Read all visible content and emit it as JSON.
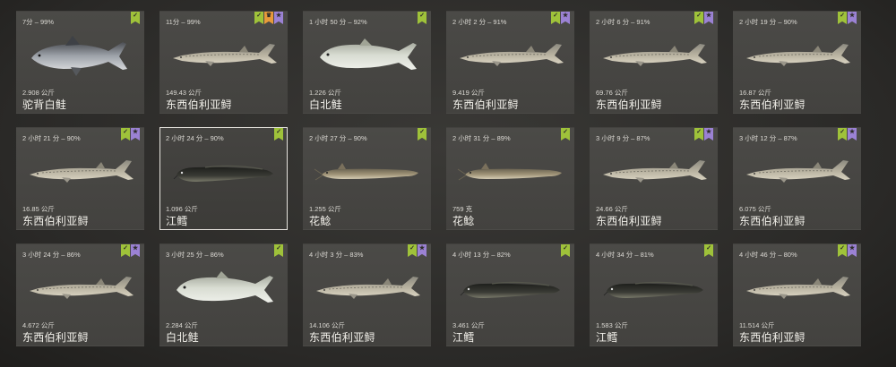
{
  "catches": [
    {
      "time": "7分 – 99%",
      "weight": "2.908 公斤",
      "name": "驼背白鲑",
      "species": "whitefish",
      "badges": [
        "green"
      ]
    },
    {
      "time": "11分 – 99%",
      "weight": "149.43 公斤",
      "name": "东西伯利亚鲟",
      "species": "sturgeon",
      "badges": [
        "green",
        "orange",
        "purple"
      ]
    },
    {
      "time": "1 小时 50 分 – 92%",
      "weight": "1.226 公斤",
      "name": "白北鲑",
      "species": "nelma",
      "badges": [
        "green"
      ]
    },
    {
      "time": "2 小时 2 分 – 91%",
      "weight": "9.419 公斤",
      "name": "东西伯利亚鲟",
      "species": "sturgeon",
      "badges": [
        "green",
        "purple"
      ]
    },
    {
      "time": "2 小时 6 分 – 91%",
      "weight": "69.76 公斤",
      "name": "东西伯利亚鲟",
      "species": "sturgeon",
      "badges": [
        "green",
        "purple"
      ]
    },
    {
      "time": "2 小时 19 分 – 90%",
      "weight": "16.87 公斤",
      "name": "东西伯利亚鲟",
      "species": "sturgeon",
      "badges": [
        "green",
        "purple"
      ]
    },
    {
      "time": "2 小时 21 分 – 90%",
      "weight": "16.85 公斤",
      "name": "东西伯利亚鲟",
      "species": "sturgeon",
      "badges": [
        "green",
        "purple"
      ]
    },
    {
      "time": "2 小时 24 分 – 90%",
      "weight": "1.096 公斤",
      "name": "江鳕",
      "species": "burbot",
      "badges": [
        "green"
      ],
      "selected": true
    },
    {
      "time": "2 小时 27 分 – 90%",
      "weight": "1.255 公斤",
      "name": "花鲶",
      "species": "catfish",
      "badges": [
        "green"
      ]
    },
    {
      "time": "2 小时 31 分 – 89%",
      "weight": "759 克",
      "name": "花鲶",
      "species": "catfish",
      "badges": [
        "green"
      ]
    },
    {
      "time": "3 小时 9 分 – 87%",
      "weight": "24.66 公斤",
      "name": "东西伯利亚鲟",
      "species": "sturgeon",
      "badges": [
        "green",
        "purple"
      ]
    },
    {
      "time": "3 小时 12 分 – 87%",
      "weight": "6.075 公斤",
      "name": "东西伯利亚鲟",
      "species": "sturgeon",
      "badges": [
        "green",
        "purple"
      ]
    },
    {
      "time": "3 小时 24 分 – 86%",
      "weight": "4.672 公斤",
      "name": "东西伯利亚鲟",
      "species": "sturgeon",
      "badges": [
        "green",
        "purple"
      ]
    },
    {
      "time": "3 小时 25 分 – 86%",
      "weight": "2.284 公斤",
      "name": "白北鲑",
      "species": "nelma",
      "badges": [
        "green"
      ]
    },
    {
      "time": "4 小时 3 分 – 83%",
      "weight": "14.106 公斤",
      "name": "东西伯利亚鲟",
      "species": "sturgeon",
      "badges": [
        "green",
        "purple"
      ]
    },
    {
      "time": "4 小时 13 分 – 82%",
      "weight": "3.461 公斤",
      "name": "江鳕",
      "species": "burbot",
      "badges": [
        "green"
      ]
    },
    {
      "time": "4 小时 34 分 – 81%",
      "weight": "1.583 公斤",
      "name": "江鳕",
      "species": "burbot",
      "badges": [
        "green"
      ]
    },
    {
      "time": "4 小时 46 分 – 80%",
      "weight": "11.514 公斤",
      "name": "东西伯利亚鲟",
      "species": "sturgeon",
      "badges": [
        "green",
        "purple"
      ]
    }
  ],
  "badge_icons": {
    "green": "check-icon",
    "orange": "trophy-icon",
    "purple": "star-icon"
  },
  "colors": {
    "green": "#9fc23a",
    "orange": "#e79a3a",
    "purple": "#9b82d4",
    "card": "#4b4a47"
  }
}
